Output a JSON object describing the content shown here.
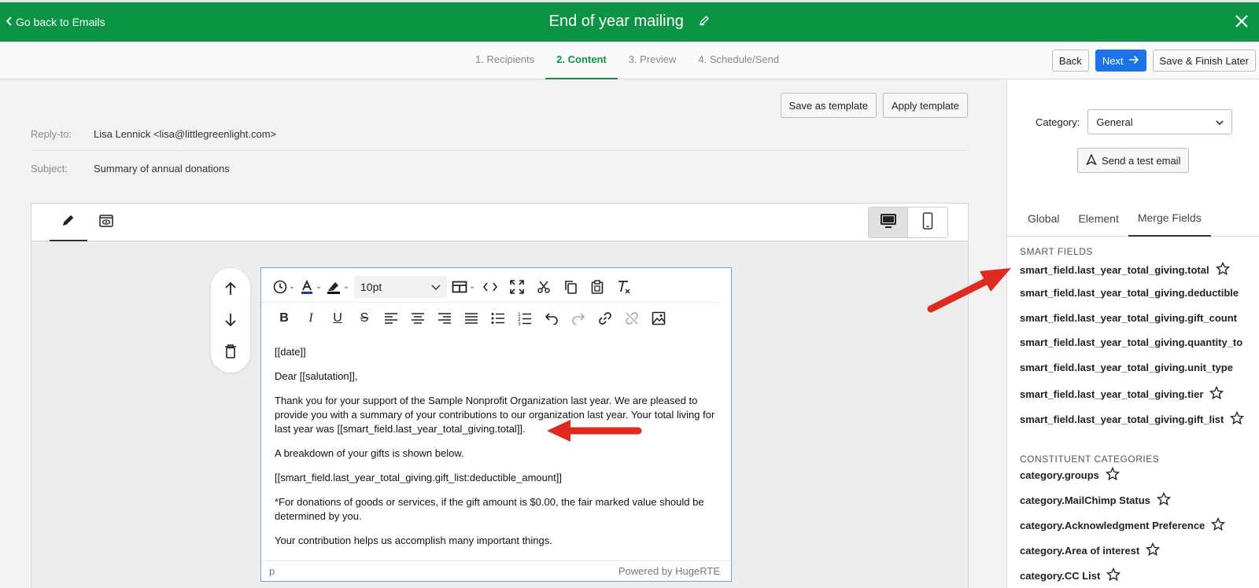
{
  "header": {
    "back_label": "Go back to Emails",
    "title": "End of year mailing"
  },
  "steps": [
    "1. Recipients",
    "2. Content",
    "3. Preview",
    "4. Schedule/Send"
  ],
  "nav": {
    "back": "Back",
    "next": "Next",
    "save_finish": "Save & Finish Later"
  },
  "templates": {
    "save": "Save as template",
    "apply": "Apply template"
  },
  "fields": {
    "reply_to_label": "Reply-to:",
    "reply_to_value": "Lisa Lennick <lisa@littlegreenlight.com>",
    "subject_label": "Subject:",
    "subject_value": "Summary of annual donations"
  },
  "editor": {
    "font_size": "10pt",
    "paragraphs": [
      "[[date]]",
      "Dear [[salutation]],",
      "Thank you for your support of the Sample Nonprofit Organization last year. We are pleased to provide you with a summary of your contributions to our organization last year. Your total living for last year was [[smart_field.last_year_total_giving.total]].",
      "A breakdown of your gifts is shown below.",
      "[[smart_field.last_year_total_giving.gift_list:deductible_amount]]",
      "*For donations of goods or services, if the gift amount is $0.00, the fair marked value should be determined by you.",
      "Your contribution helps us accomplish many important things."
    ],
    "status_path": "p",
    "powered_by": "Powered by HugeRTE"
  },
  "right": {
    "category_label": "Category:",
    "category_value": "General",
    "test_email": "Send a test email",
    "tabs": [
      "Global",
      "Element",
      "Merge Fields"
    ],
    "smart_title": "SMART FIELDS",
    "smart_fields": [
      "smart_field.last_year_total_giving.total",
      "smart_field.last_year_total_giving.deductible",
      "smart_field.last_year_total_giving.gift_count",
      "smart_field.last_year_total_giving.quantity_to",
      "smart_field.last_year_total_giving.unit_type",
      "smart_field.last_year_total_giving.tier",
      "smart_field.last_year_total_giving.gift_list"
    ],
    "cat_title": "CONSTITUENT CATEGORIES",
    "categories": [
      "category.groups",
      "category.MailChimp Status",
      "category.Acknowledgment Preference",
      "category.Area of interest",
      "category.CC List"
    ]
  },
  "colors": {
    "brand_green": "#0a9444",
    "primary_blue": "#1a73e8",
    "annotation_red": "#e02a1f"
  }
}
